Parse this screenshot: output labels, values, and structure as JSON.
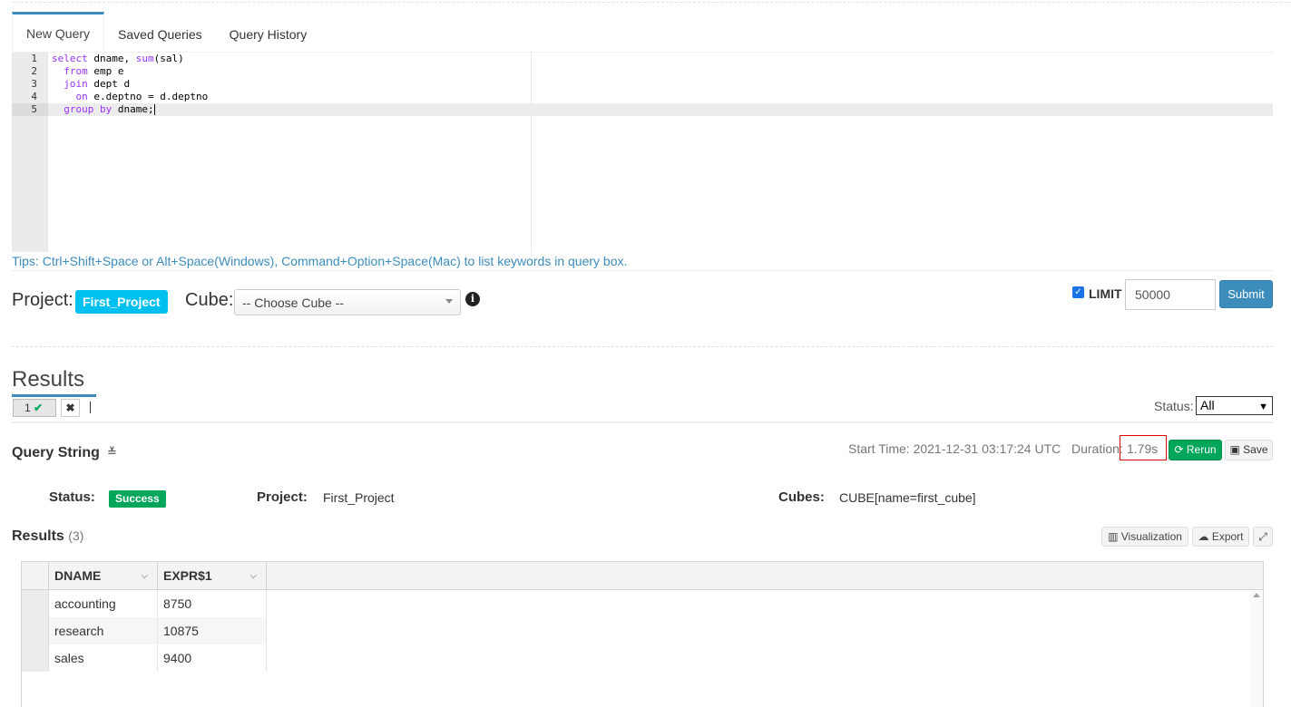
{
  "tabs": [
    {
      "label": "New Query"
    },
    {
      "label": "Saved Queries"
    },
    {
      "label": "Query History"
    }
  ],
  "editor": {
    "lines": [
      {
        "num": "1",
        "parts": [
          [
            "kw",
            "select"
          ],
          [
            "t",
            " dname, "
          ],
          [
            "kw",
            "sum"
          ],
          [
            "t",
            "(sal)"
          ]
        ]
      },
      {
        "num": "2",
        "parts": [
          [
            "t",
            "  "
          ],
          [
            "kw",
            "from"
          ],
          [
            "t",
            " emp e"
          ]
        ]
      },
      {
        "num": "3",
        "parts": [
          [
            "t",
            "  "
          ],
          [
            "kw",
            "join"
          ],
          [
            "t",
            " dept d"
          ]
        ]
      },
      {
        "num": "4",
        "parts": [
          [
            "t",
            "    "
          ],
          [
            "kw",
            "on"
          ],
          [
            "t",
            " e.deptno = d.deptno"
          ]
        ]
      },
      {
        "num": "5",
        "parts": [
          [
            "t",
            "  "
          ],
          [
            "kw",
            "group"
          ],
          [
            "t",
            " "
          ],
          [
            "kw",
            "by"
          ],
          [
            "t",
            " dname;"
          ]
        ]
      }
    ]
  },
  "tips": "Tips: Ctrl+Shift+Space or Alt+Space(Windows), Command+Option+Space(Mac) to list keywords in query box.",
  "project": {
    "label": "Project:",
    "value": "First_Project"
  },
  "cube": {
    "label": "Cube:",
    "placeholder": "-- Choose Cube --"
  },
  "limit": {
    "label": "LIMIT",
    "value": "50000",
    "checked": true
  },
  "submit_label": "Submit",
  "results": {
    "title": "Results",
    "query_tab": "1",
    "status_label": "Status:",
    "status_value": "All"
  },
  "query_string": {
    "title": "Query String",
    "start_time": "Start Time: 2021-12-31 03:17:24 UTC",
    "duration_label": "Duration:",
    "duration_value": "1.79s",
    "rerun_label": "Rerun",
    "save_label": "Save"
  },
  "info": {
    "status_label": "Status:",
    "status_value": "Success",
    "project_label": "Project:",
    "project_value": "First_Project",
    "cubes_label": "Cubes:",
    "cubes_value": "CUBE[name=first_cube]"
  },
  "result_table": {
    "title": "Results",
    "count": "(3)",
    "visualization_label": "Visualization",
    "export_label": "Export",
    "columns": [
      "DNAME",
      "EXPR$1"
    ],
    "rows": [
      [
        "accounting",
        "8750"
      ],
      [
        "research",
        "10875"
      ],
      [
        "sales",
        "9400"
      ]
    ]
  },
  "colors": {
    "primary": "#3c8dbc",
    "success": "#00a65a",
    "info": "#00c0ef",
    "highlight_border": "#dd0000"
  }
}
